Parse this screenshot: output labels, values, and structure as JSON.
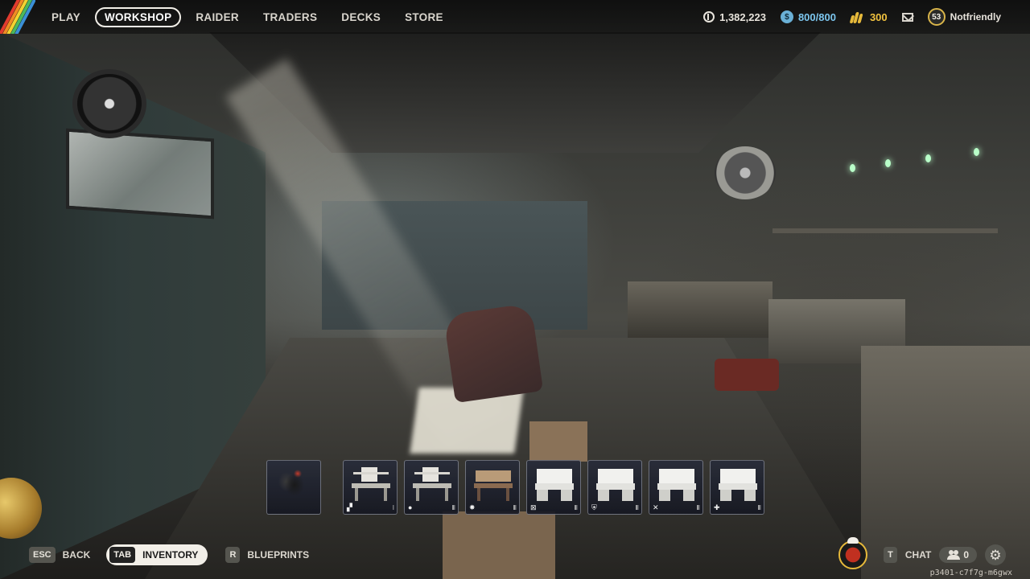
{
  "nav": {
    "items": [
      {
        "label": "PLAY",
        "active": false
      },
      {
        "label": "WORKSHOP",
        "active": true
      },
      {
        "label": "RAIDER",
        "active": false
      },
      {
        "label": "TRADERS",
        "active": false
      },
      {
        "label": "DECKS",
        "active": false
      },
      {
        "label": "STORE",
        "active": false
      }
    ]
  },
  "currencies": {
    "coins": "1,382,223",
    "tokens": "800/800",
    "credits": "300"
  },
  "player": {
    "level": "53",
    "name": "Notfriendly"
  },
  "hotbar": {
    "slots": [
      {
        "item": "rooster",
        "icon": "",
        "marker": ""
      },
      {
        "item": "workbench",
        "icon": "▞",
        "marker": "I"
      },
      {
        "item": "workbench",
        "icon": "●",
        "marker": "III"
      },
      {
        "item": "workbench",
        "icon": "✸",
        "marker": "III"
      },
      {
        "item": "workbench",
        "icon": "⊠",
        "marker": "III"
      },
      {
        "item": "workbench",
        "icon": "⛨",
        "marker": "III"
      },
      {
        "item": "workbench",
        "icon": "✕",
        "marker": "III"
      },
      {
        "item": "workbench",
        "icon": "✚",
        "marker": "III"
      }
    ]
  },
  "controls": {
    "back": {
      "key": "ESC",
      "label": "BACK"
    },
    "inventory": {
      "key": "TAB",
      "label": "INVENTORY"
    },
    "blueprints": {
      "key": "R",
      "label": "BLUEPRINTS"
    }
  },
  "social": {
    "chat_key": "T",
    "chat_label": "CHAT",
    "friends_count": "0"
  },
  "session_id": "p3401-c7f7g-m6gwx",
  "colors": {
    "accent_blue": "#7cc6ee",
    "accent_gold": "#f1c23f",
    "active_pill": "#f2efe8"
  }
}
